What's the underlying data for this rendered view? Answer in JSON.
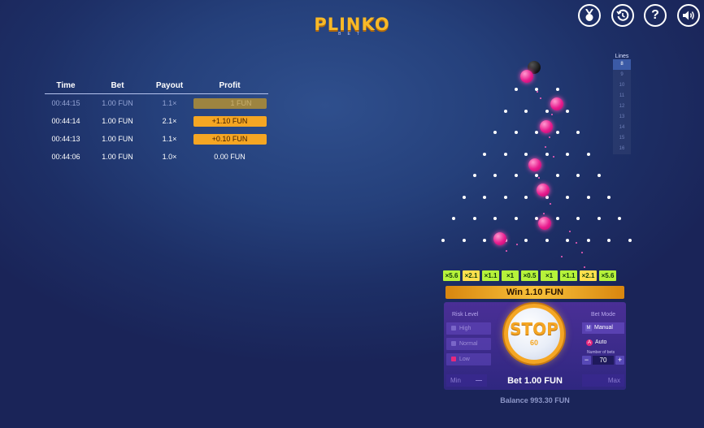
{
  "logo": {
    "text": "PLINKO",
    "subtext": "BET"
  },
  "top_icons": {
    "achievements": "medal-icon",
    "history": "history-clock-icon",
    "help": "help-icon",
    "sound": "speaker-icon"
  },
  "history": {
    "headers": {
      "time": "Time",
      "bet": "Bet",
      "payout": "Payout",
      "profit": "Profit"
    },
    "rows": [
      {
        "time": "00:44:15",
        "bet": "1.00 FUN",
        "payout": "1.1×",
        "profit": "1 FUN"
      },
      {
        "time": "00:44:14",
        "bet": "1.00 FUN",
        "payout": "2.1×",
        "profit": "+1.10 FUN"
      },
      {
        "time": "00:44:13",
        "bet": "1.00 FUN",
        "payout": "1.1×",
        "profit": "+0.10 FUN"
      },
      {
        "time": "00:44:06",
        "bet": "1.00 FUN",
        "payout": "1.0×",
        "profit": "0.00 FUN"
      }
    ]
  },
  "lines": {
    "label": "Lines",
    "options": [
      "8",
      "9",
      "10",
      "11",
      "12",
      "13",
      "14",
      "15",
      "16"
    ],
    "selected": "8"
  },
  "board": {
    "rows": 8,
    "ball_color": "#e81c8e"
  },
  "multipliers": {
    "values": [
      "×5.6",
      "×2.1",
      "×1.1",
      "×1",
      "×0.5",
      "×1",
      "×1.1",
      "×2.1",
      "×5.6"
    ],
    "color": "#b6f23a"
  },
  "win_text": "Win 1.10 FUN",
  "risk": {
    "title": "Risk Level",
    "options": [
      "High",
      "Normal",
      "Low"
    ],
    "selected": "Low"
  },
  "stop_button": {
    "label": "STOP",
    "count": "60"
  },
  "bet_mode": {
    "title": "Bet Mode",
    "manual_key": "M",
    "manual_label": "Manual",
    "auto_key": "A",
    "auto_label": "Auto",
    "number_of_bets_label": "Number of bets",
    "number_of_bets": "70",
    "minus": "−",
    "plus": "+"
  },
  "bet": {
    "min_label": "Min",
    "max_label": "Max",
    "label": "Bet 1.00 FUN"
  },
  "balance": "Balance 993.30 FUN"
}
